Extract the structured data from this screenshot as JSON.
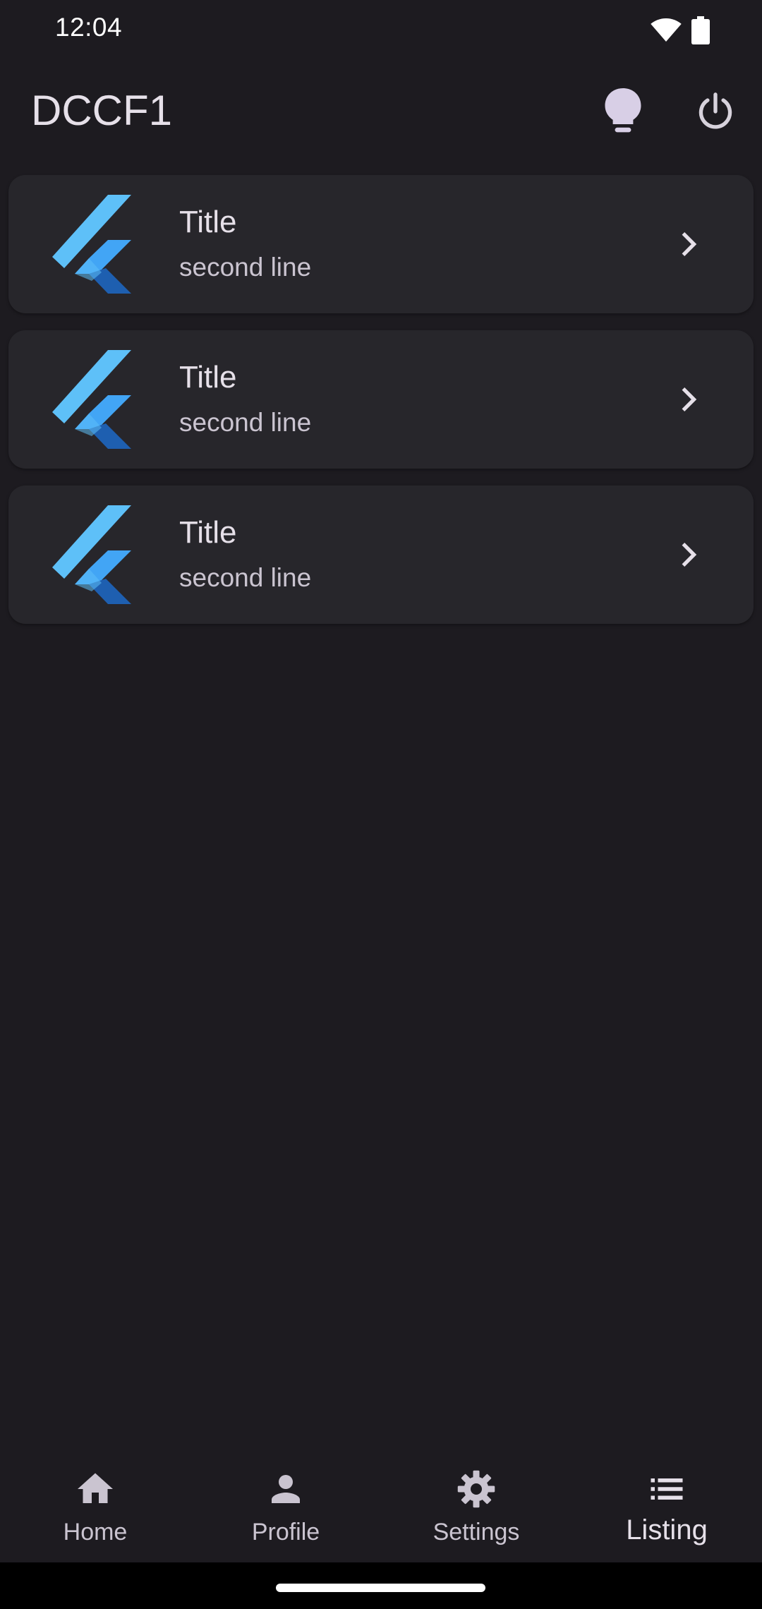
{
  "status_bar": {
    "time": "12:04",
    "wifi_icon": "wifi-icon",
    "battery_icon": "battery-icon"
  },
  "app_bar": {
    "title": "DCCF1",
    "actions": [
      "lightbulb-icon",
      "power-icon"
    ]
  },
  "list": {
    "items": [
      {
        "title": "Title",
        "subtitle": "second line",
        "icon": "flutter-logo-icon",
        "trailing_icon": "chevron-right-icon"
      },
      {
        "title": "Title",
        "subtitle": "second line",
        "icon": "flutter-logo-icon",
        "trailing_icon": "chevron-right-icon"
      },
      {
        "title": "Title",
        "subtitle": "second line",
        "icon": "flutter-logo-icon",
        "trailing_icon": "chevron-right-icon"
      }
    ]
  },
  "bottom_nav": {
    "selected": "Listing",
    "items": [
      {
        "label": "Home",
        "icon": "home-icon"
      },
      {
        "label": "Profile",
        "icon": "person-icon"
      },
      {
        "label": "Settings",
        "icon": "gear-icon"
      },
      {
        "label": "Listing",
        "icon": "list-icon"
      }
    ]
  },
  "colors": {
    "background": "#1d1b20",
    "card": "#27262b",
    "text_primary": "#e6e0e9",
    "text_secondary": "#cac4d0",
    "logo_light_blue": "#5ec0f8",
    "logo_mid_blue": "#42a5f5",
    "logo_dark_blue": "#1e5fb0"
  }
}
